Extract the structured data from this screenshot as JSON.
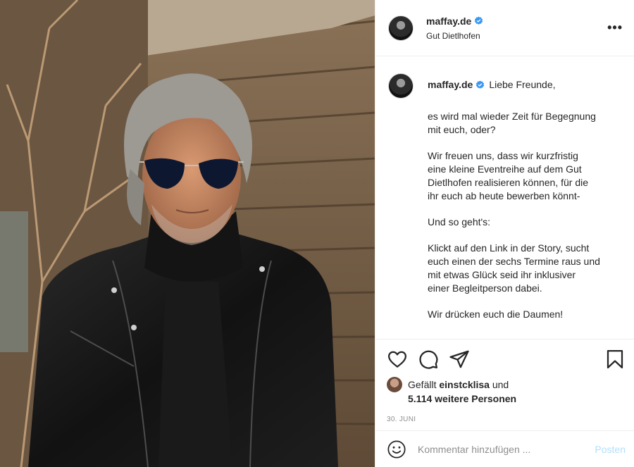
{
  "post": {
    "username": "maffay.de",
    "location": "Gut Dietlhofen",
    "verified": true,
    "more_icon": "more-horizontal-icon",
    "caption": {
      "greeting": "Liebe Freunde,",
      "paragraphs": [
        "es wird mal wieder Zeit für Begegnung\nmit euch, oder?",
        "Wir freuen uns, dass wir kurzfristig\neine kleine Eventreihe auf dem Gut\nDietlhofen realisieren können, für die\nihr euch ab heute bewerben könnt-",
        "Und so geht's:",
        "Klickt auf den Link in der Story, sucht\neuch einen der sechs Termine raus und\nmit etwas Glück seid ihr inklusiver\neiner Begleitperson dabei.",
        "Wir drücken euch die Daumen!"
      ]
    },
    "actions": [
      "heart-icon",
      "comment-icon",
      "share-icon",
      "bookmark-icon"
    ],
    "likes": {
      "prefix": "Gefällt",
      "user": "einstcklisa",
      "connector": "und",
      "others": "5.114 weitere Personen"
    },
    "date": "30. JUNI",
    "comment": {
      "placeholder": "Kommentar hinzufügen ...",
      "submit_label": "Posten",
      "emoji_icon": "emoji-smile-icon"
    }
  },
  "colors": {
    "verified": "#3897f0",
    "post_button_disabled": "#b2dffc",
    "muted_text": "#8e8e8e"
  }
}
